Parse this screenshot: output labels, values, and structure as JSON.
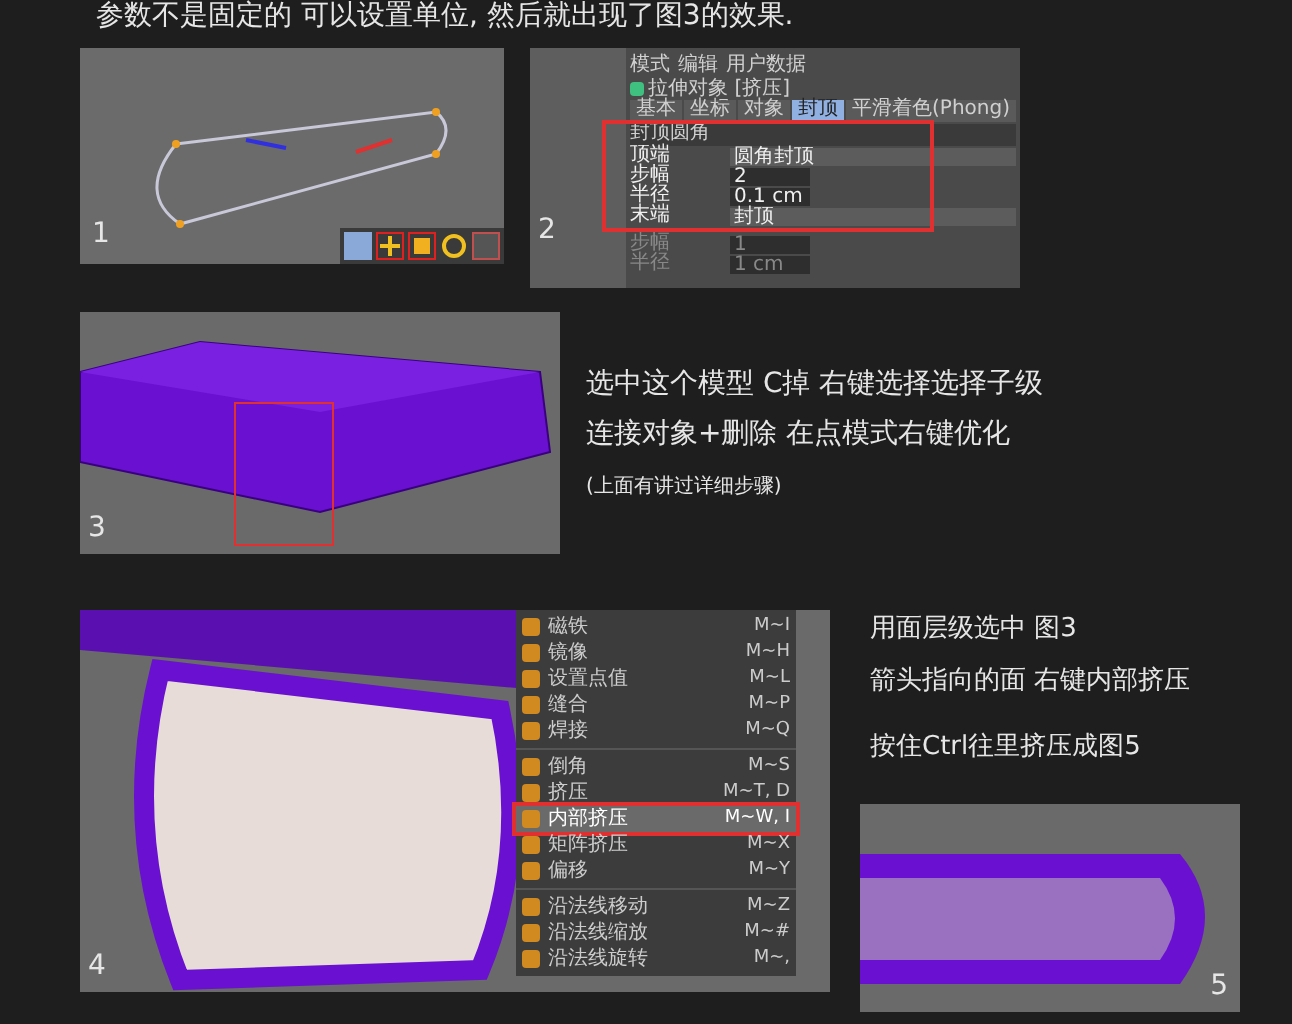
{
  "caption": "参数不是固定的 可以设置单位, 然后就出现了图3的效果.",
  "step1": {
    "number": "1"
  },
  "step2": {
    "number": "2",
    "toolbar": [
      "模式",
      "编辑",
      "用户数据"
    ],
    "object_title": "拉伸对象 [挤压]",
    "tabs": [
      {
        "label": "基本",
        "selected": false
      },
      {
        "label": "坐标",
        "selected": false
      },
      {
        "label": "对象",
        "selected": false
      },
      {
        "label": "封顶",
        "selected": true
      },
      {
        "label": "平滑着色(Phong)",
        "selected": false
      }
    ],
    "section": "封顶圆角",
    "rows": [
      {
        "label": "顶端",
        "value": "圆角封顶",
        "kind": "dropdown",
        "disabled": false
      },
      {
        "label": "步幅",
        "value": "2",
        "kind": "number",
        "disabled": false
      },
      {
        "label": "半径",
        "value": "0.1 cm",
        "kind": "number",
        "disabled": false
      },
      {
        "label": "末端",
        "value": "封顶",
        "kind": "dropdown",
        "disabled": false
      },
      {
        "label": "步幅",
        "value": "1",
        "kind": "number",
        "disabled": true
      },
      {
        "label": "半径",
        "value": "1 cm",
        "kind": "number",
        "disabled": true
      }
    ]
  },
  "step3": {
    "number": "3",
    "notes": [
      "选中这个模型 C掉 右键选择选择子级",
      "连接对象+删除 在点模式右键优化"
    ],
    "hint": "(上面有讲过详细步骤)"
  },
  "step4": {
    "number": "4",
    "menu": [
      [
        {
          "label": "磁铁",
          "shortcut": "M~I",
          "selected": false
        },
        {
          "label": "镜像",
          "shortcut": "M~H",
          "selected": false
        },
        {
          "label": "设置点值",
          "shortcut": "M~L",
          "selected": false
        },
        {
          "label": "缝合",
          "shortcut": "M~P",
          "selected": false
        },
        {
          "label": "焊接",
          "shortcut": "M~Q",
          "selected": false
        }
      ],
      [
        {
          "label": "倒角",
          "shortcut": "M~S",
          "selected": false
        },
        {
          "label": "挤压",
          "shortcut": "M~T, D",
          "selected": false
        },
        {
          "label": "内部挤压",
          "shortcut": "M~W, I",
          "selected": true
        },
        {
          "label": "矩阵挤压",
          "shortcut": "M~X",
          "selected": false
        },
        {
          "label": "偏移",
          "shortcut": "M~Y",
          "selected": false
        }
      ],
      [
        {
          "label": "沿法线移动",
          "shortcut": "M~Z",
          "selected": false
        },
        {
          "label": "沿法线缩放",
          "shortcut": "M~#",
          "selected": false
        },
        {
          "label": "沿法线旋转",
          "shortcut": "M~,",
          "selected": false
        }
      ]
    ],
    "notes": [
      "用面层级选中 图3",
      "箭头指向的面 右键内部挤压"
    ],
    "note2": "按住Ctrl往里挤压成图5"
  },
  "step5": {
    "number": "5"
  }
}
